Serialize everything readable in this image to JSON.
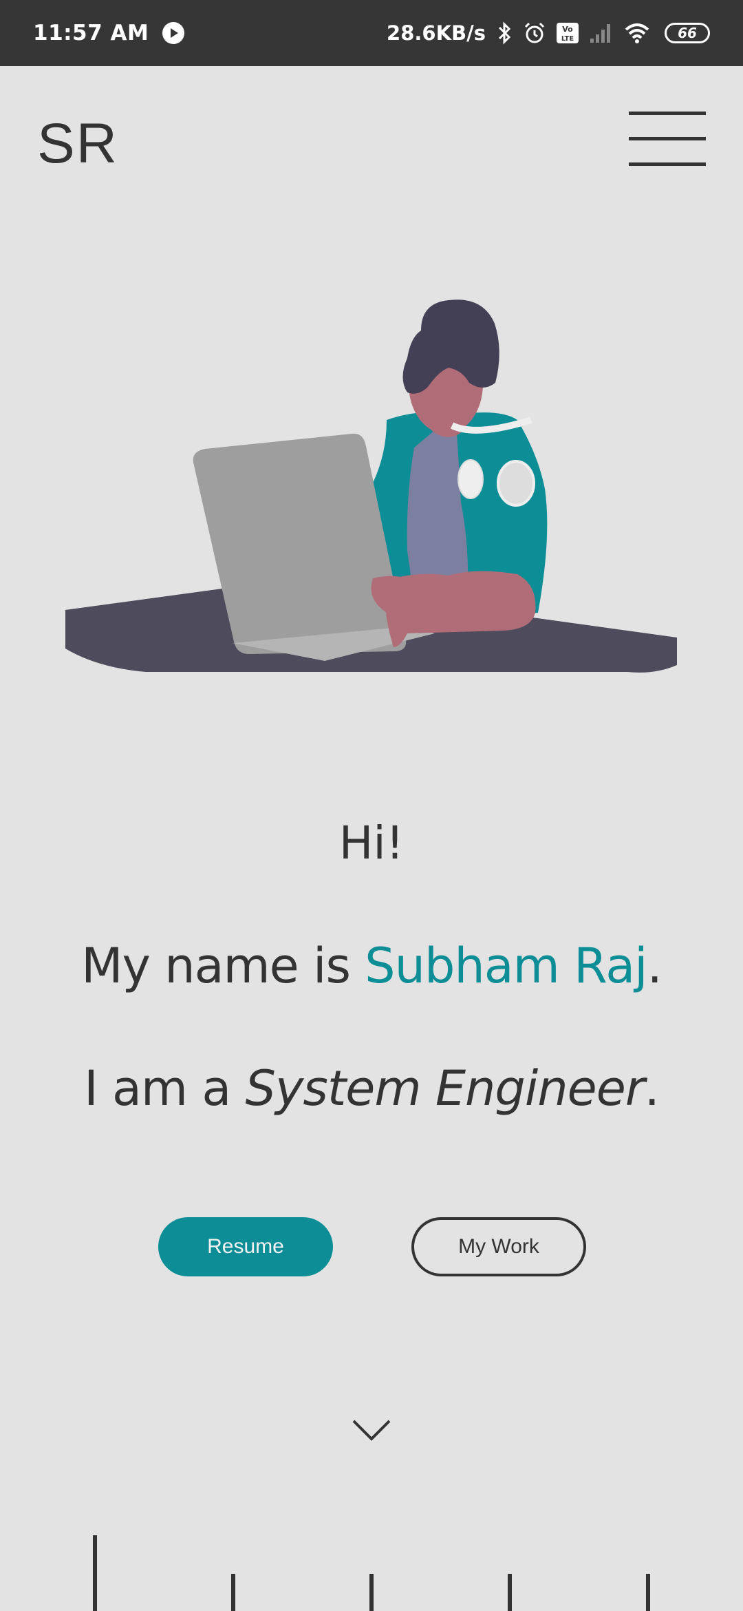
{
  "status_bar": {
    "time": "11:57 AM",
    "network_speed": "28.6KB/s",
    "battery": "66",
    "icons": [
      "play-icon",
      "bluetooth-icon",
      "alarm-icon",
      "volte-icon",
      "signal-icon",
      "wifi-icon",
      "battery-icon"
    ]
  },
  "header": {
    "logo": "SR",
    "menu_icon": "hamburger-menu-icon"
  },
  "hero": {
    "illustration": "person-with-laptop-illustration",
    "colors": {
      "background": "#e3e3e3",
      "accent": "#0d8e96",
      "desk": "#4e4c5c",
      "laptop": "#9e9e9e",
      "skin": "#b06d78",
      "hair": "#433f55",
      "shirt": "#7c7fa0"
    }
  },
  "intro": {
    "greeting": "Hi!",
    "name_prefix": "My name is ",
    "name": "Subham Raj",
    "name_suffix": ".",
    "role_prefix": "I am a ",
    "role": "System Engineer",
    "role_suffix": "."
  },
  "buttons": {
    "resume": "Resume",
    "my_work": "My Work"
  },
  "scroll": {
    "icon": "chevron-down-icon"
  }
}
